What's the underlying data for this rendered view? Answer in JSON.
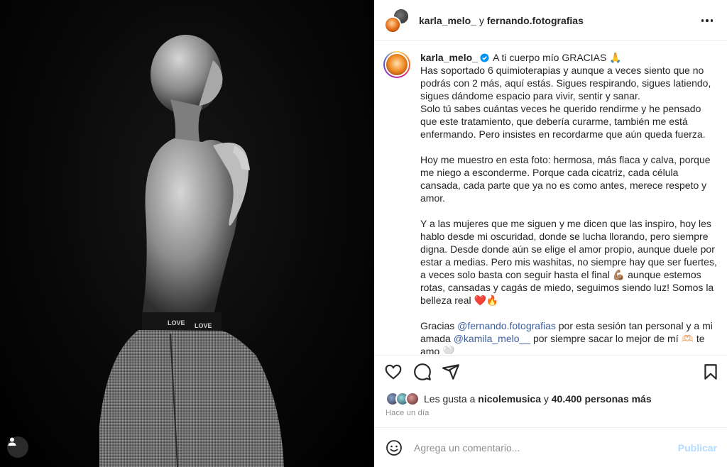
{
  "post": {
    "photo_alt": "",
    "header": {
      "author": "karla_melo_",
      "separator": " y ",
      "coauthor": "fernando.fotografias"
    },
    "caption": {
      "username": "karla_melo_",
      "first_line": "A ti cuerpo mío GRACIAS 🙏",
      "paragraphs": [
        [
          "Has soportado 6 quimioterapias y aunque a veces siento que no podrás con 2 más, aquí estás. Sigues respirando, sigues latiendo, sigues dándome espacio para vivir, sentir y sanar.",
          "Solo tú sabes cuántas veces he querido rendirme y he pensado que este tratamiento, que debería curarme, también me está enfermando. Pero insistes en recordarme que aún queda fuerza."
        ],
        [
          "Hoy me muestro en esta foto: hermosa, más flaca y calva, porque me niego a esconderme. Porque cada cicatriz, cada célula cansada, cada parte que ya no es como antes, merece respeto y amor."
        ],
        [
          "Y a las mujeres que me siguen y me dicen que las inspiro, hoy les hablo desde mi oscuridad, donde se lucha llorando, pero siempre digna. Desde donde aún se elige el amor propio, aunque duele por estar a medias. Pero mis washitas, no siempre hay que ser fuertes, a veces solo basta con seguir hasta el final 💪🏽 aunque estemos rotas, cansadas y cagás de miedo, seguimos siendo luz!  Somos la belleza real ❤️🔥"
        ]
      ],
      "thanks_prefix": "Gracias ",
      "thanks_mention_1": "@fernando.fotografias",
      "thanks_middle": " por esta sesión tan personal y a mi amada ",
      "thanks_mention_2": "@kamila_melo__",
      "thanks_suffix": " por siempre sacar lo mejor de mí 🫶🏻",
      "thanks_cut": "te amo 🤍"
    },
    "actions": {
      "like_icon": "heart-icon",
      "comment_icon": "comment-icon",
      "share_icon": "share-icon",
      "save_icon": "bookmark-icon"
    },
    "likes": {
      "prefix": "Les gusta a ",
      "user": "nicolemusica",
      "middle": " y ",
      "count": "40.400 personas más"
    },
    "timestamp": "Hace un día",
    "comment": {
      "placeholder": "Agrega un comentario...",
      "publish_label": "Publicar"
    }
  },
  "colors": {
    "link": "#3c5f9e",
    "verified": "#0095f6",
    "publish_disabled": "#b3dbff",
    "muted": "#8e8e8e"
  }
}
